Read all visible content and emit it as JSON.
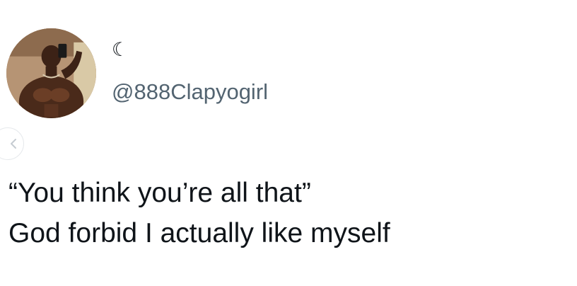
{
  "tweet": {
    "display_name": "☾",
    "handle": "@888Clapyogirl",
    "avatar_icon": "profile-photo",
    "text_lines": [
      "“You think you’re all that”",
      "God forbid I actually like myself"
    ]
  },
  "nav": {
    "prev_icon": "chevron-left-icon"
  },
  "colors": {
    "text_primary": "#0f1419",
    "text_secondary": "#536471",
    "background": "#ffffff",
    "nav_border": "#e6e9ec"
  }
}
